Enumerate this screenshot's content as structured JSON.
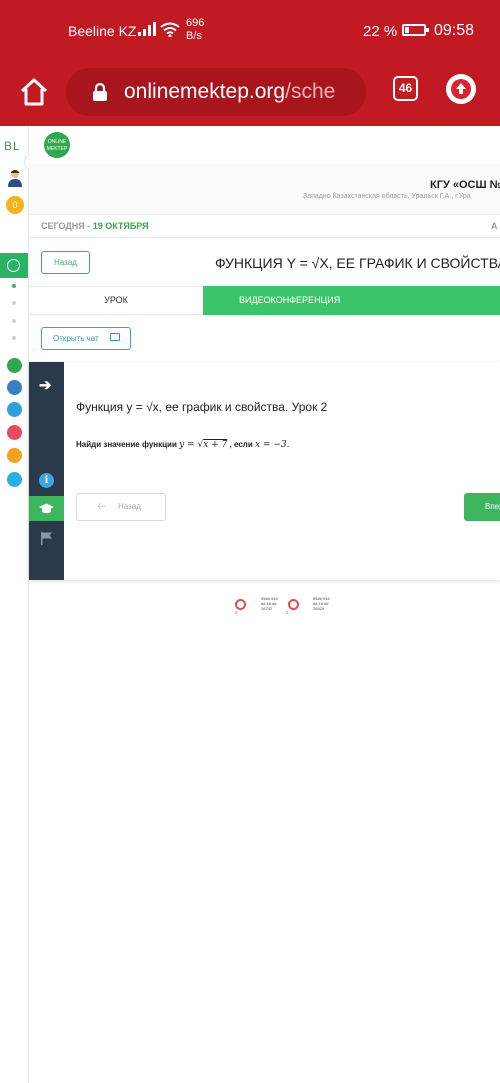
{
  "status_bar": {
    "carrier": "Beeline KZ",
    "speed_value": "696",
    "speed_unit": "B/s",
    "battery": "22 %",
    "battery_level": 0.22,
    "time": "09:58"
  },
  "browser": {
    "domain": "onlinemektep.org",
    "path": "/sche",
    "tab_count": "46"
  },
  "sidebar": {
    "logo": "BL",
    "coins": "0",
    "apps": [
      "ONLINE MEKTEP",
      "SM",
      "BL",
      "Quiz",
      "A",
      "?"
    ]
  },
  "header": {
    "logo_text": "ONLINE MEKTEP",
    "school_name": "КГУ «ОСШ №",
    "school_address": "Западно Казахстанская область, Уральск Г.А., г.Ура",
    "date_label": "СЕГОДНЯ - ",
    "date_value": "19 ОКТЯБРЯ",
    "date_right": "А"
  },
  "lesson_header": {
    "back_label": "Назад",
    "title": "ФУНКЦИЯ Y = √X, ЕЕ ГРАФИК И СВОЙСТВА"
  },
  "tabs": {
    "lesson": "УРОК",
    "video": "ВИДЕОКОНФЕРЕНЦИЯ"
  },
  "chat": {
    "label": "Открыть чат"
  },
  "task": {
    "title": "Функция y = √x, ее график и свойства. Урок 2",
    "text_prefix": "Найди значение функции",
    "formula_y": "y = ",
    "formula_radicand": "x + 7",
    "text_middle": ", если",
    "formula_condition": "x = −3.",
    "back_label": "Назад",
    "next_label": "Вперёд"
  },
  "footer_stats": [
    {
      "count": "2",
      "lines": [
        "95## 944",
        "## 16 ##",
        "26742"
      ]
    },
    {
      "count": "2",
      "lines": [
        "95## 944",
        "## 16 ##",
        "26929"
      ]
    }
  ],
  "colors": {
    "browser_red": "#c21a22",
    "accent_green": "#3cb55e",
    "nav_dark": "#2b3a4a"
  }
}
